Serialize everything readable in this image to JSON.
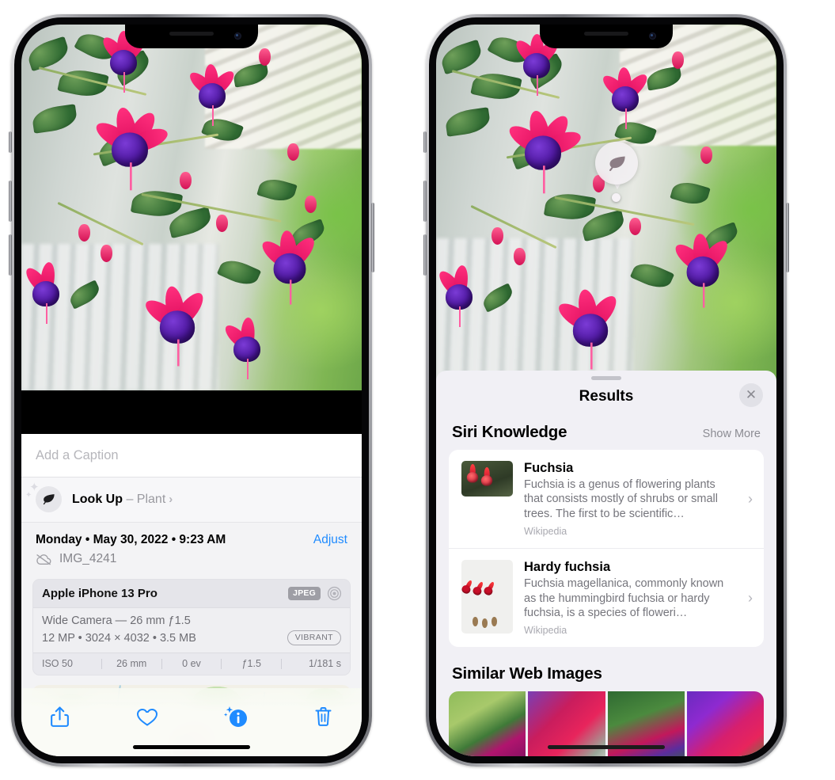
{
  "left_phone": {
    "caption_placeholder": "Add a Caption",
    "lookup": {
      "label": "Look Up",
      "dash": " – ",
      "subject": "Plant",
      "chevron": "›",
      "icon": "leaf-icon"
    },
    "metadata": {
      "date_line": "Monday • May 30, 2022 • 9:23 AM",
      "adjust_label": "Adjust",
      "filename": "IMG_4241",
      "cloud_icon": "icloud-slash-icon"
    },
    "camera_card": {
      "device": "Apple iPhone 13 Pro",
      "format_badge": "JPEG",
      "aperture_icon": "aperture-icon",
      "lens_line": "Wide Camera — 26 mm ƒ1.5",
      "specs_line": "12 MP • 3024 × 4032 • 3.5 MB",
      "style_badge": "VIBRANT",
      "exif": [
        "ISO 50",
        "26 mm",
        "0 ev",
        "ƒ1.5",
        "1/181 s"
      ]
    },
    "toolbar": [
      {
        "name": "share-icon",
        "label": "Share"
      },
      {
        "name": "heart-icon",
        "label": "Favorite"
      },
      {
        "name": "info-sparkle-icon",
        "label": "Info"
      },
      {
        "name": "trash-icon",
        "label": "Delete"
      }
    ],
    "accent_color": "#1f8bff"
  },
  "right_phone": {
    "visual_lookup_badge": {
      "icon": "leaf-icon"
    },
    "results": {
      "title": "Results",
      "close_label": "✕",
      "siri_knowledge": {
        "heading": "Siri Knowledge",
        "action": "Show More",
        "items": [
          {
            "title": "Fuchsia",
            "description": "Fuchsia is a genus of flowering plants that consists mostly of shrubs or small trees. The first to be scientific…",
            "source": "Wikipedia",
            "chevron": "›"
          },
          {
            "title": "Hardy fuchsia",
            "description": "Fuchsia magellanica, commonly known as the hummingbird fuchsia or hardy fuchsia, is a species of floweri…",
            "source": "Wikipedia",
            "chevron": "›"
          }
        ]
      },
      "similar_web_images": {
        "heading": "Similar Web Images",
        "count": 4
      }
    },
    "panel_color": "#f1f0f5"
  }
}
